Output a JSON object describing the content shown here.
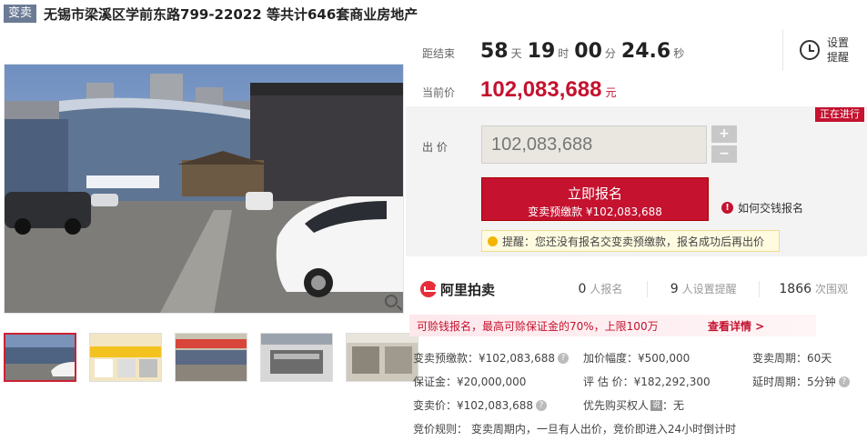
{
  "header": {
    "tag": "变卖",
    "title": "无锡市梁溪区学前东路799-22022 等共计646套商业房地产"
  },
  "countdown": {
    "label": "距结束",
    "days": "58",
    "days_unit": "天",
    "hours": "19",
    "hours_unit": "时",
    "minutes": "00",
    "minutes_unit": "分",
    "seconds": "24.6",
    "seconds_unit": "秒"
  },
  "reminder": {
    "label": "设置提醒"
  },
  "current_price": {
    "label": "当前价",
    "value": "102,083,688",
    "unit": "元"
  },
  "bid": {
    "status": "正在进行",
    "label": "出 价",
    "input_value": "102,083,688",
    "plus": "+",
    "minus": "−",
    "signup_title": "立即报名",
    "signup_sub": "变卖预缴款 ¥102,083,688",
    "info_link": "如何交钱报名",
    "tip": "提醒：您还没有报名交变卖预缴款，报名成功后再出价"
  },
  "platform": {
    "name": "阿里拍卖",
    "stats": [
      {
        "num": "0",
        "label": "人报名"
      },
      {
        "num": "9",
        "label": "人设置提醒"
      },
      {
        "num": "1866",
        "label": "次围观"
      }
    ]
  },
  "promo": {
    "text": "可赊钱报名，最高可赊保证金的70%，上限100万",
    "link": "查看详情 >"
  },
  "details": {
    "deposit_pre": "变卖预缴款：¥102,083,688",
    "increment": "加价幅度：¥500,000",
    "period": "变卖周期：60天",
    "deposit": "保证金：¥20,000,000",
    "valuation": "评 估 价：¥182,292,300",
    "delay": "延时周期：5分钟",
    "sale_price": "变卖价：¥102,083,688",
    "priority": "优先购买权人",
    "priority_badge": "说",
    "priority_value": "：无",
    "rule": "竞价规则：  变卖周期内，一旦有人出价，竞价即进入24小时倒计时"
  },
  "icons": {
    "zoom": "magnifier-icon",
    "clock": "alarm-clock-icon",
    "info": "info-icon",
    "bulb": "lightbulb-icon",
    "help": "question-icon"
  },
  "colors": {
    "accent": "#c4122f",
    "tag_bg": "#6b7b95"
  }
}
